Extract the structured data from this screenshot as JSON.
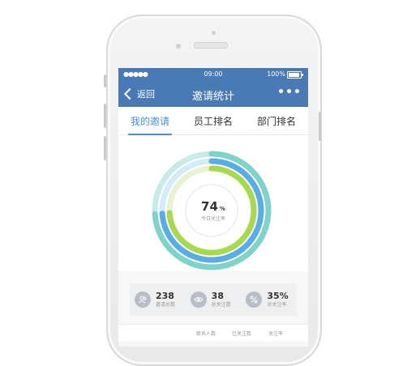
{
  "status_bar": {
    "signal": "●●●●●",
    "time": "09:00",
    "battery": "100%"
  },
  "nav": {
    "back_label": "返回",
    "title": "邀请统计",
    "more": "•••"
  },
  "tabs": [
    {
      "label": "我的邀请",
      "active": true
    },
    {
      "label": "员工排名",
      "active": false
    },
    {
      "label": "部门排名",
      "active": false
    }
  ],
  "ring": {
    "value": "74",
    "unit": "%",
    "label": "今日关注率"
  },
  "chart_data": {
    "type": "ring",
    "rings": [
      {
        "name": "outer",
        "fraction": 0.74,
        "color": "#7fd3c9"
      },
      {
        "name": "second",
        "fraction": 0.74,
        "color": "#5aace8"
      },
      {
        "name": "third",
        "fraction": 0.74,
        "color": "#a8d94a"
      }
    ]
  },
  "stats": [
    {
      "value": "238",
      "label": "邀请总数",
      "icon": "users-icon"
    },
    {
      "value": "38",
      "label": "总关注数",
      "icon": "eye-icon"
    },
    {
      "value": "35%",
      "label": "总关注率",
      "icon": "percent-icon"
    }
  ],
  "table_headers": [
    "联系人数",
    "已关注数",
    "关注率"
  ],
  "colors": {
    "nav": "#4a7ab5",
    "accent": "#4a90d9"
  }
}
